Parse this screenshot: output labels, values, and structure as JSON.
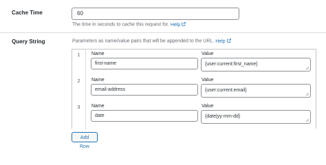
{
  "cache_time": {
    "label": "Cache Time",
    "value": "60",
    "description": "The time in seconds to cache this request for.",
    "help_label": "Help"
  },
  "query_string": {
    "label": "Query String",
    "description": "Parameters as name/value pairs that will be appended to the URL.",
    "help_label": "Help",
    "name_header": "Name",
    "value_header": "Value",
    "rows": [
      {
        "num": "1",
        "name": "first-name",
        "value": "{user:current:first_name}"
      },
      {
        "num": "2",
        "name": "email-address",
        "value": "{user:current:email}"
      },
      {
        "num": "3",
        "name": "date",
        "value": "{date|yy-mm-dd}"
      }
    ],
    "add_row_label": "Add Row"
  },
  "colors": {
    "link": "#2271b1",
    "border": "#8c8f94",
    "divider": "#dcdcde"
  },
  "icons": [
    "external-link-icon",
    "resize-grip-icon"
  ]
}
